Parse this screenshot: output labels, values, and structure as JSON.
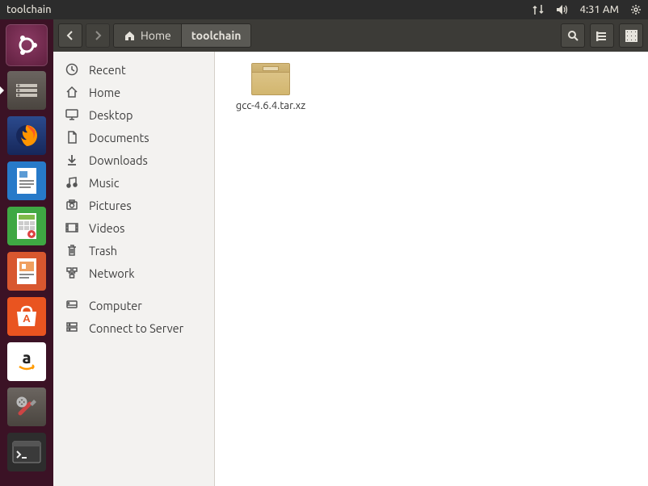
{
  "menubar": {
    "title": "toolchain",
    "time": "4:31 AM"
  },
  "toolbar": {
    "crumb": {
      "home": "Home",
      "current": "toolchain"
    }
  },
  "sidebar": {
    "items": [
      {
        "label": "Recent",
        "icon": "clock"
      },
      {
        "label": "Home",
        "icon": "home"
      },
      {
        "label": "Desktop",
        "icon": "desktop"
      },
      {
        "label": "Documents",
        "icon": "documents"
      },
      {
        "label": "Downloads",
        "icon": "download"
      },
      {
        "label": "Music",
        "icon": "music"
      },
      {
        "label": "Pictures",
        "icon": "pictures"
      },
      {
        "label": "Videos",
        "icon": "videos"
      },
      {
        "label": "Trash",
        "icon": "trash"
      },
      {
        "label": "Network",
        "icon": "network"
      }
    ],
    "items2": [
      {
        "label": "Computer",
        "icon": "computer"
      },
      {
        "label": "Connect to Server",
        "icon": "server"
      }
    ]
  },
  "files": [
    {
      "name": "gcc-4.6.4.tar.xz"
    }
  ],
  "launcher": {
    "apps": [
      "ubuntu",
      "files",
      "firefox",
      "writer",
      "calc",
      "impress",
      "software",
      "amazon",
      "settings",
      "terminal"
    ]
  }
}
